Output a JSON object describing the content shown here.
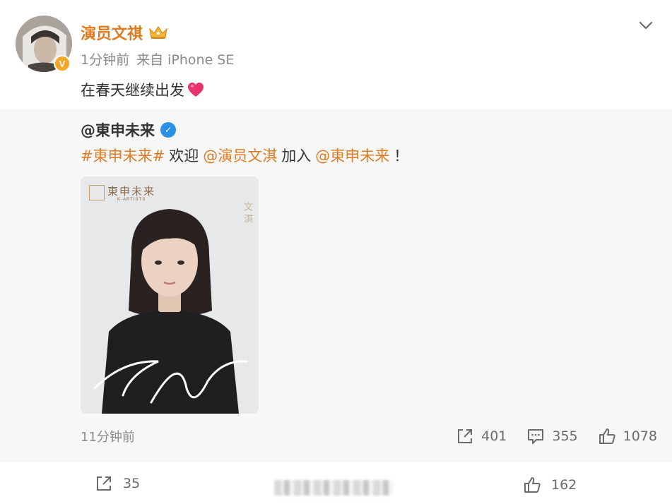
{
  "post": {
    "author": "演员文祺",
    "time": "1分钟前",
    "source": "来自 iPhone SE",
    "text": "在春天继续出发"
  },
  "repost": {
    "author_prefix": "@",
    "author": "東申未来",
    "segments": {
      "hashtag": "#東申未来#",
      "welcome": "欢迎",
      "mention1": "@演员文淇",
      "join": "加入",
      "mention2": "@東申未来",
      "end": "！"
    },
    "image": {
      "logo_text": "東申未来",
      "logo_sub": "K-ARTISTS",
      "vertical_name": "文淇"
    },
    "time_ago": "11分钟前",
    "stats": {
      "reposts": "401",
      "comments": "355",
      "likes": "1078"
    }
  },
  "bottom": {
    "reposts": "35",
    "likes": "162"
  },
  "colors": {
    "accent": "#e07a1f",
    "verified_blue": "#2b90e8",
    "heart": "#e8336d"
  }
}
